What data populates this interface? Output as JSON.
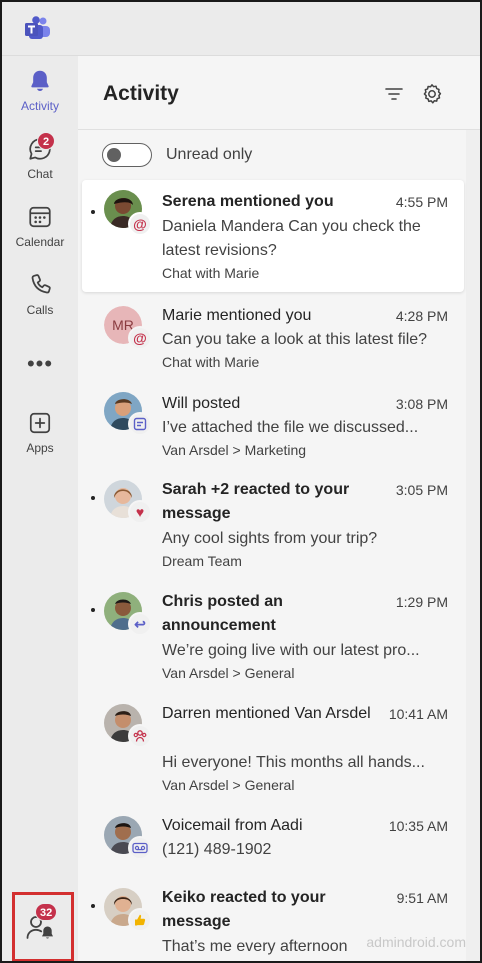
{
  "rail": {
    "items": [
      {
        "label": "Activity",
        "icon": "bell-icon",
        "active": true
      },
      {
        "label": "Chat",
        "icon": "chat-icon",
        "badge": "2"
      },
      {
        "label": "Calendar",
        "icon": "calendar-icon"
      },
      {
        "label": "Calls",
        "icon": "phone-icon"
      },
      {
        "label": "",
        "icon": "more-icon"
      },
      {
        "label": "Apps",
        "icon": "apps-icon"
      }
    ],
    "bottom_badge": "32"
  },
  "activity": {
    "title": "Activity",
    "filter_icon": "filter-icon",
    "settings_icon": "gear-icon",
    "unread_toggle_label": "Unread only",
    "items": [
      {
        "title": "Serena mentioned you",
        "time": "4:55 PM",
        "preview": "Daniela Mandera Can you check the latest revisions?",
        "source": "Chat with Marie",
        "type": "mention",
        "unread": true
      },
      {
        "title": "Marie mentioned you",
        "time": "4:28 PM",
        "preview": "Can you take a look at this latest file?",
        "source": "Chat with Marie",
        "type": "mention",
        "initials": "MR",
        "unread": false
      },
      {
        "title": "Will posted",
        "time": "3:08 PM",
        "preview": "I’ve attached the file we discussed...",
        "source": "Van Arsdel > Marketing",
        "type": "post",
        "unread": false
      },
      {
        "title": "Sarah +2 reacted to your message",
        "time": "3:05 PM",
        "preview": "Any cool sights from your trip?",
        "source": "Dream Team",
        "type": "heart",
        "unread": true
      },
      {
        "title": "Chris posted an announcement",
        "time": "1:29 PM",
        "preview": "We’re going live with our latest pro...",
        "source": "Van Arsdel > General",
        "type": "reply",
        "unread": true
      },
      {
        "title": "Darren mentioned Van Arsdel",
        "time": "10:41 AM",
        "preview": "Hi everyone! This months all hands...",
        "source": "Van Arsdel > General",
        "type": "team",
        "unread": false
      },
      {
        "title": "Voicemail from Aadi",
        "time": "10:35 AM",
        "preview": "(121) 489-1902",
        "source": "",
        "type": "voicemail",
        "unread": false
      },
      {
        "title": "Keiko reacted to your message",
        "time": "9:51 AM",
        "preview": "That’s me every afternoon",
        "source": "",
        "type": "like",
        "unread": true
      }
    ]
  },
  "watermark": "admindroid.com",
  "colors": {
    "accent": "#5b5fc7",
    "badge": "#c4314b",
    "mention": "#c4314b",
    "highlight_box": "#d32f2f"
  }
}
